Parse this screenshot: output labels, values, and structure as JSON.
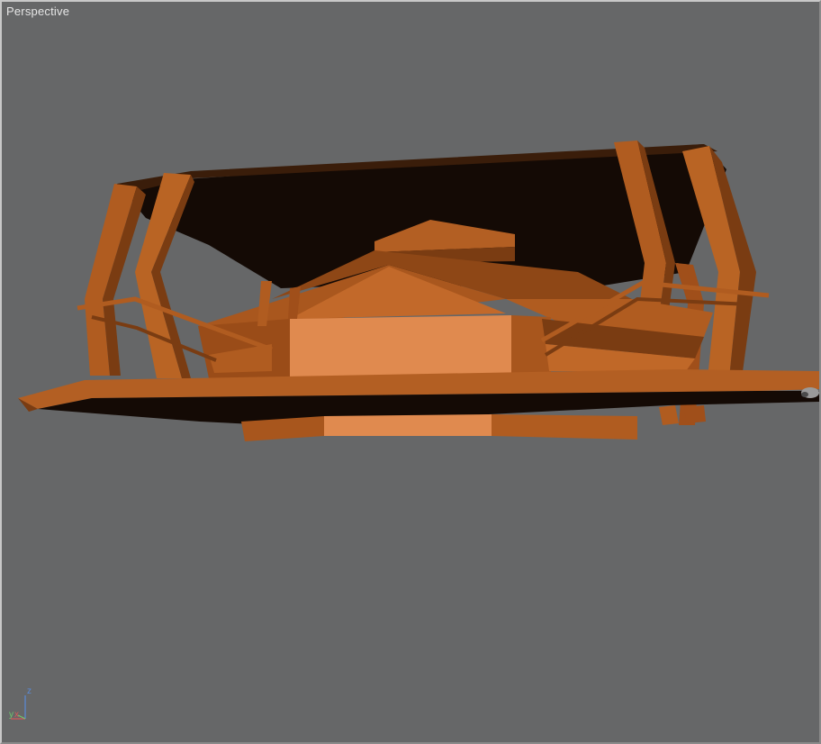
{
  "viewport": {
    "label": "Perspective",
    "background": "#666768"
  },
  "model": {
    "colors": {
      "light": "#d98446",
      "mid": "#a8561d",
      "dark": "#7a3c12",
      "shadow": "#140a05",
      "face": "#e08a4f"
    }
  },
  "axis_gizmo": {
    "z": "z",
    "y": "y",
    "x": "x",
    "z_color": "#5a8ad8",
    "y_color": "#6ec86e",
    "x_color": "#d65a5a"
  }
}
